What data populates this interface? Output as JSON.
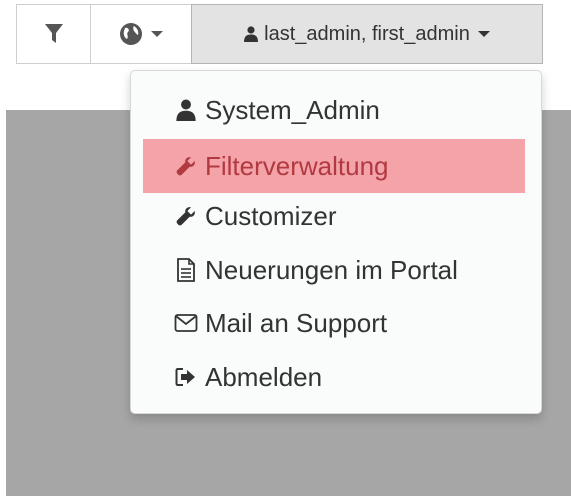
{
  "toolbar": {
    "filter_icon": "filter-icon",
    "language_icon": "globe-icon",
    "user_icon": "user-icon",
    "user_label": "last_admin, first_admin"
  },
  "menu": {
    "items": [
      {
        "label": "System_Admin",
        "icon": "user-icon",
        "highlighted": false
      },
      {
        "label": "Filterverwaltung",
        "icon": "wrench-icon",
        "highlighted": true
      },
      {
        "label": "Customizer",
        "icon": "wrench-icon",
        "highlighted": false
      },
      {
        "label": "Neuerungen im Portal",
        "icon": "document-icon",
        "highlighted": false
      },
      {
        "label": "Mail an Support",
        "icon": "envelope-icon",
        "highlighted": false
      },
      {
        "label": "Abmelden",
        "icon": "sign-out-icon",
        "highlighted": false
      }
    ]
  },
  "colors": {
    "highlight_bg": "#f4a3a8",
    "highlight_text": "#b03a40",
    "backdrop": "#a6a6a6"
  }
}
